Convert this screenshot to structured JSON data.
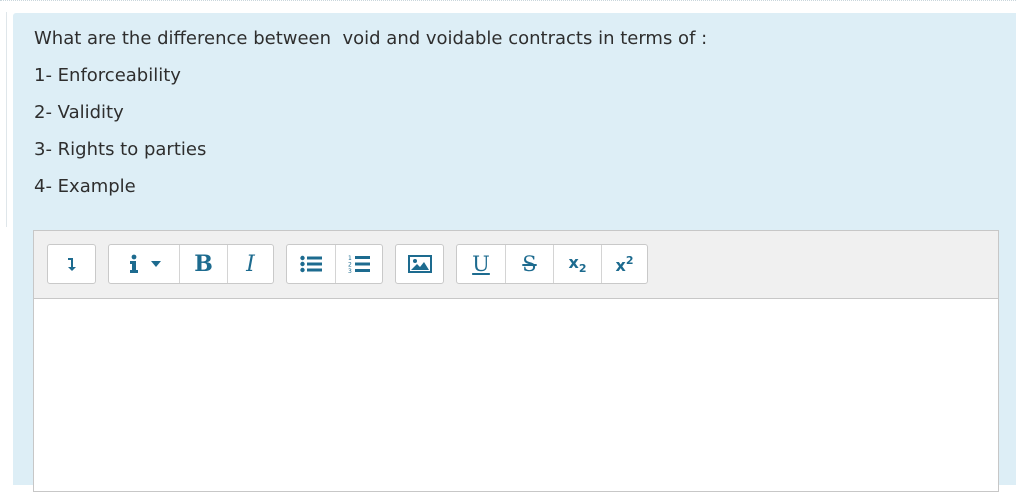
{
  "question": {
    "title": "What are the difference between  void and voidable contracts in terms of :",
    "items": [
      "1- Enforceability",
      "2- Validity",
      "3- Rights to parties",
      "4- Example"
    ]
  },
  "toolbar": {
    "icons": {
      "format": "arrow-down-icon",
      "info": "info-icon",
      "bold": "bold-icon",
      "italic": "italic-icon",
      "bullet_list": "bullet-list-icon",
      "numbered_list": "numbered-list-icon",
      "image": "image-icon",
      "underline": "underline-icon",
      "strikethrough": "strikethrough-icon",
      "subscript": "subscript-icon",
      "superscript": "superscript-icon"
    },
    "bold_label": "B",
    "italic_label": "I",
    "underline_label": "U",
    "strike_label": "S",
    "sub_base": "x",
    "sub_small": "2",
    "sup_base": "x",
    "sup_small": "2"
  },
  "editor": {
    "content": ""
  },
  "colors": {
    "panel_bg": "#ddeef6",
    "icon_accent": "#1d6b8f",
    "toolbar_bg": "#f0f0f0"
  }
}
